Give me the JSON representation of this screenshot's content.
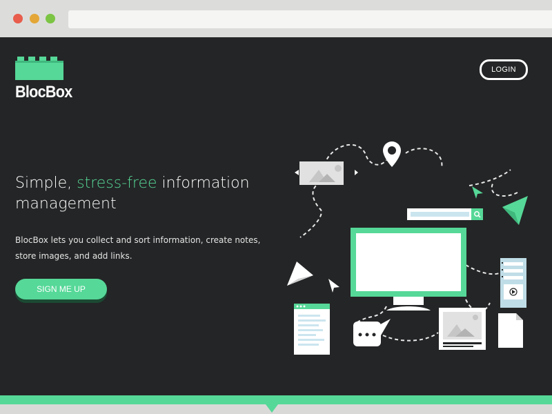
{
  "brand": {
    "name": "BlocBox",
    "accent": "#56d898",
    "background": "#242526"
  },
  "nav": {
    "login_label": "LOGIN"
  },
  "hero": {
    "headline_prefix": "Simple, ",
    "headline_accent": "stress-free",
    "headline_suffix": " information management",
    "description": "BlocBox lets you collect and sort information, create notes, store images, and add links.",
    "cta_label": "SIGN ME UP"
  },
  "browser": {
    "window_controls": [
      "close",
      "minimize",
      "maximize"
    ],
    "control_colors": [
      "#e85d4c",
      "#e4a737",
      "#7cc443"
    ]
  },
  "illustration": {
    "icons": [
      "monitor-icon",
      "map-pin-icon",
      "search-bar-icon",
      "image-slider-icon",
      "paper-plane-icon",
      "cursor-icon",
      "document-icon",
      "chat-bubble-icon",
      "photo-frame-icon",
      "file-icon",
      "media-list-icon"
    ]
  }
}
